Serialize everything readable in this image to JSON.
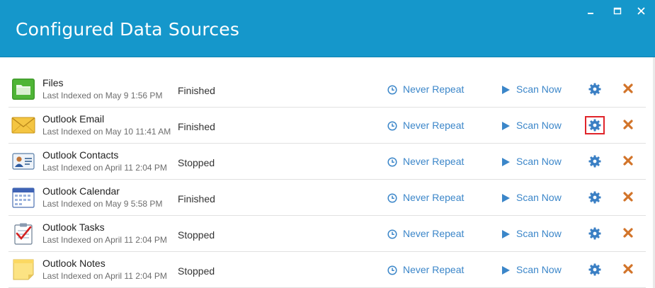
{
  "window": {
    "title": "Configured Data Sources",
    "accent_color": "#1597cb",
    "link_color": "#3b86c9",
    "gear_color": "#3a7fc4",
    "delete_color": "#d2742a",
    "highlight_color": "#e0242a"
  },
  "sources": [
    {
      "name": "Files",
      "last_indexed": "Last Indexed on May 9 1:56 PM",
      "status": "Finished",
      "repeat": "Never Repeat",
      "scan": "Scan Now",
      "icon": "folder-icon"
    },
    {
      "name": "Outlook Email",
      "last_indexed": "Last Indexed on May 10 11:41 AM",
      "status": "Finished",
      "repeat": "Never Repeat",
      "scan": "Scan Now",
      "icon": "envelope-icon",
      "settings_highlighted": true
    },
    {
      "name": "Outlook Contacts",
      "last_indexed": "Last Indexed on April 11 2:04 PM",
      "status": "Stopped",
      "repeat": "Never Repeat",
      "scan": "Scan Now",
      "icon": "contact-card-icon"
    },
    {
      "name": "Outlook Calendar",
      "last_indexed": "Last Indexed on May 9 5:58 PM",
      "status": "Finished",
      "repeat": "Never Repeat",
      "scan": "Scan Now",
      "icon": "calendar-icon"
    },
    {
      "name": "Outlook Tasks",
      "last_indexed": "Last Indexed on April 11 2:04 PM",
      "status": "Stopped",
      "repeat": "Never Repeat",
      "scan": "Scan Now",
      "icon": "task-checklist-icon"
    },
    {
      "name": "Outlook Notes",
      "last_indexed": "Last Indexed on April 11 2:04 PM",
      "status": "Stopped",
      "repeat": "Never Repeat",
      "scan": "Scan Now",
      "icon": "sticky-note-icon"
    }
  ]
}
